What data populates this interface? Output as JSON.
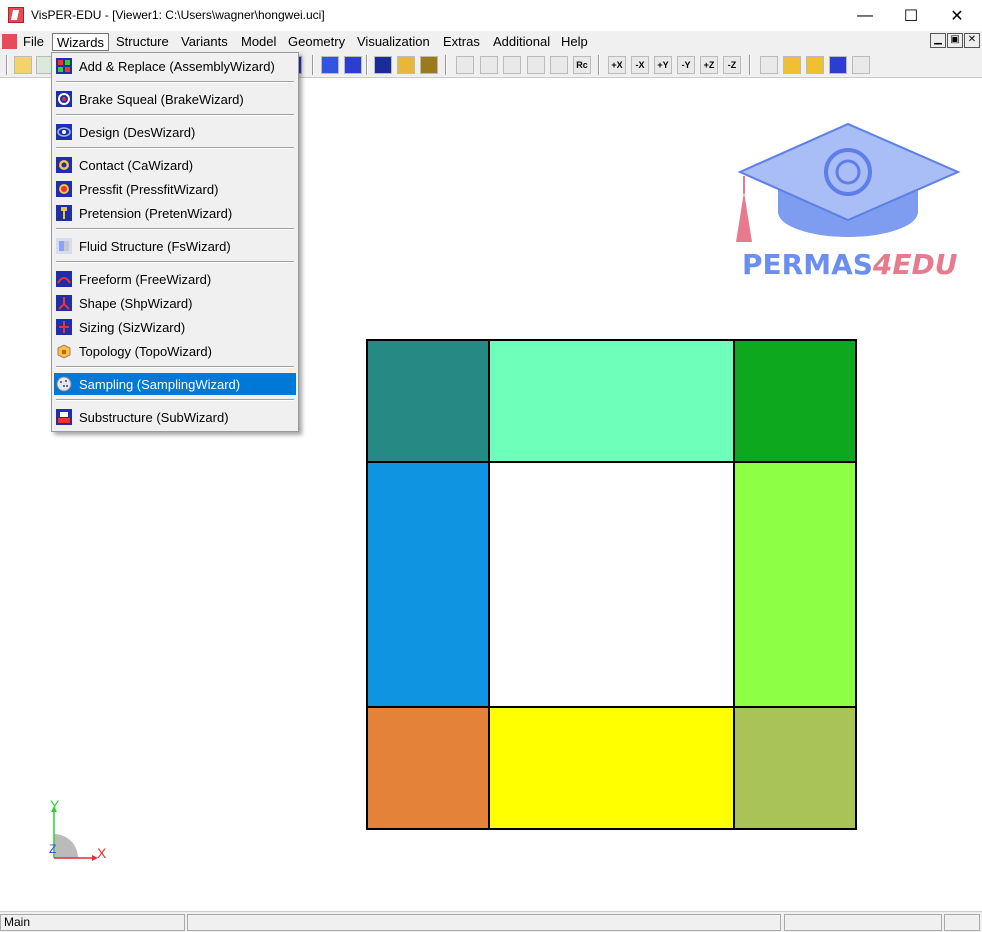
{
  "window": {
    "title": "VisPER-EDU - [Viewer1: C:\\Users\\wagner\\hongwei.uci]",
    "minimize": "—",
    "maximize": "☐",
    "close": "✕"
  },
  "menubar": {
    "items": [
      "File",
      "Wizards",
      "Structure",
      "Variants",
      "Model",
      "Geometry",
      "Visualization",
      "Extras",
      "Additional",
      "Help"
    ],
    "active": "Wizards",
    "mdi": [
      "▁",
      "▣",
      "✕"
    ]
  },
  "toolbar": {
    "axis_buttons": [
      "+X",
      "-X",
      "+Y",
      "-Y",
      "+Z",
      "-Z"
    ],
    "reset_button": "Rc"
  },
  "wizards_menu": [
    {
      "label": "Add & Replace (AssemblyWizard)",
      "icon": "assembly-icon"
    },
    {
      "label": "Brake Squeal (BrakeWizard)",
      "icon": "brake-icon"
    },
    {
      "label": "Design (DesWizard)",
      "icon": "design-icon"
    },
    {
      "label": "Contact (CaWizard)",
      "icon": "contact-icon"
    },
    {
      "label": "Pressfit (PressfitWizard)",
      "icon": "pressfit-icon"
    },
    {
      "label": "Pretension (PretenWizard)",
      "icon": "pretension-icon"
    },
    {
      "label": "Fluid Structure (FsWizard)",
      "icon": "fluid-structure-icon"
    },
    {
      "label": "Freeform (FreeWizard)",
      "icon": "freeform-icon"
    },
    {
      "label": "Shape (ShpWizard)",
      "icon": "shape-icon"
    },
    {
      "label": "Sizing (SizWizard)",
      "icon": "sizing-icon"
    },
    {
      "label": "Topology (TopoWizard)",
      "icon": "topology-icon"
    },
    {
      "label": "Sampling (SamplingWizard)",
      "icon": "sampling-icon"
    },
    {
      "label": "Substructure (SubWizard)",
      "icon": "substructure-icon"
    }
  ],
  "highlighted_item": "Sampling (SamplingWizard)",
  "logo": {
    "text_main": "PERMAS",
    "text_accent": "4EDU",
    "color_main": "#6b8ef0",
    "color_accent": "#e87a8e"
  },
  "model_cells": {
    "colors": {
      "top_left": "#258a84",
      "top_mid": "#6effbb",
      "top_right": "#0da81e",
      "mid_left": "#0f94e1",
      "mid_right": "#8dff45",
      "bot_left": "#e4823a",
      "bot_mid": "#ffff00",
      "bot_right": "#a9c357"
    }
  },
  "axes": {
    "y": "Y",
    "x": "X",
    "z": "Z",
    "y_color": "#33cc33",
    "x_color": "#e03030",
    "z_color": "#2a4be0"
  },
  "statusbar": {
    "mode": "Main"
  }
}
